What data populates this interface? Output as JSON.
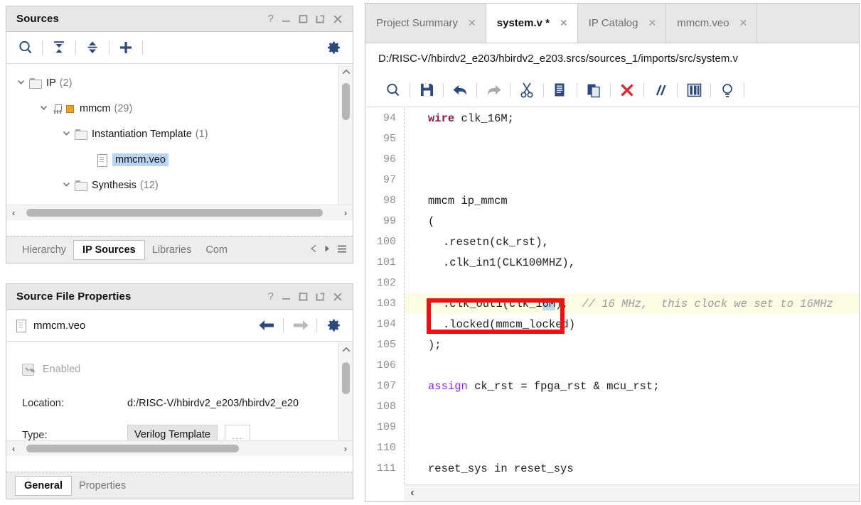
{
  "sources_panel": {
    "title": "Sources",
    "window_controls": [
      "?",
      "minimize",
      "maximize",
      "float",
      "close"
    ],
    "toolbar": [
      {
        "name": "search-icon",
        "label": "Search"
      },
      {
        "name": "collapse-all-icon",
        "label": "Collapse All"
      },
      {
        "name": "expand-all-icon",
        "label": "Expand All"
      },
      {
        "name": "add-sources-icon",
        "label": "Add Sources"
      },
      {
        "name": "settings-gear-icon",
        "label": "Settings"
      }
    ],
    "tree": [
      {
        "label": "IP",
        "count": "(2)",
        "icon": "folder-icon",
        "indent": 0,
        "expanded": true,
        "selected": false
      },
      {
        "label": "mmcm",
        "count": "(29)",
        "icon": "ip-chip-icon",
        "indent": 1,
        "expanded": true,
        "selected": false
      },
      {
        "label": "Instantiation Template",
        "count": "(1)",
        "icon": "folder-icon",
        "indent": 2,
        "expanded": true,
        "selected": false
      },
      {
        "label": "mmcm.veo",
        "count": "",
        "icon": "document-icon",
        "indent": 3,
        "expanded": null,
        "selected": true
      },
      {
        "label": "Synthesis",
        "count": "(12)",
        "icon": "folder-icon",
        "indent": 2,
        "expanded": true,
        "selected": false
      }
    ],
    "bottom_tabs": [
      {
        "label": "Hierarchy",
        "active": false
      },
      {
        "label": "IP Sources",
        "active": true
      },
      {
        "label": "Libraries",
        "active": false
      },
      {
        "label": "Com",
        "active": false
      }
    ],
    "tab_nav": [
      "prev-arrow-icon",
      "next-arrow-icon",
      "tab-menu-icon"
    ]
  },
  "properties_panel": {
    "title": "Source File Properties",
    "window_controls": [
      "?",
      "minimize",
      "maximize",
      "float",
      "close"
    ],
    "file_name": "mmcm.veo",
    "nav": [
      {
        "name": "back-arrow-icon",
        "enabled": true
      },
      {
        "name": "forward-arrow-icon",
        "enabled": false
      },
      {
        "name": "settings-gear-icon",
        "enabled": true
      }
    ],
    "rows": [
      {
        "type": "checkbox",
        "label": "Enabled",
        "checked": true,
        "disabled": true
      },
      {
        "type": "text",
        "label": "Location:",
        "value": "d:/RISC-V/hbirdv2_e203/hbirdv2_e20"
      },
      {
        "type": "select",
        "label": "Type:",
        "value": "Verilog Template",
        "browse": "..."
      }
    ],
    "bottom_tabs": [
      {
        "label": "General",
        "active": true
      },
      {
        "label": "Properties",
        "active": false
      }
    ]
  },
  "editor": {
    "tabs": [
      {
        "label": "Project Summary",
        "active": false,
        "modified": false
      },
      {
        "label": "system.v *",
        "active": true,
        "modified": true
      },
      {
        "label": "IP Catalog",
        "active": false,
        "modified": false
      },
      {
        "label": "mmcm.veo",
        "active": false,
        "modified": false
      }
    ],
    "file_path": "D:/RISC-V/hbirdv2_e203/hbirdv2_e203.srcs/sources_1/imports/src/system.v",
    "toolbar": [
      {
        "name": "find-icon",
        "label": "Find",
        "enabled": true
      },
      {
        "name": "save-icon",
        "label": "Save File",
        "enabled": true
      },
      {
        "name": "undo-icon",
        "label": "Undo",
        "enabled": true
      },
      {
        "name": "redo-icon",
        "label": "Redo",
        "enabled": false
      },
      {
        "name": "cut-icon",
        "label": "Cut",
        "enabled": true
      },
      {
        "name": "copy-icon",
        "label": "Copy",
        "enabled": true
      },
      {
        "name": "paste-icon",
        "label": "Paste",
        "enabled": true
      },
      {
        "name": "delete-icon",
        "label": "Delete",
        "enabled": true
      },
      {
        "name": "comment-icon",
        "label": "Toggle Comment",
        "enabled": true
      },
      {
        "name": "column-select-icon",
        "label": "Column Select",
        "enabled": true
      },
      {
        "name": "bulb-icon",
        "label": "Tips",
        "enabled": true
      }
    ],
    "lines": [
      {
        "n": "94",
        "indent": 1,
        "segments": [
          {
            "t": "wire",
            "c": "kw-wire"
          },
          {
            "t": " clk_16M;",
            "c": ""
          }
        ],
        "current": false
      },
      {
        "n": "95",
        "indent": 0,
        "segments": [],
        "current": false
      },
      {
        "n": "96",
        "indent": 0,
        "segments": [],
        "current": false
      },
      {
        "n": "97",
        "indent": 0,
        "segments": [],
        "current": false
      },
      {
        "n": "98",
        "indent": 1,
        "segments": [
          {
            "t": "mmcm ip_mmcm",
            "c": ""
          }
        ],
        "current": false
      },
      {
        "n": "99",
        "indent": 1,
        "segments": [
          {
            "t": "(",
            "c": ""
          }
        ],
        "current": false
      },
      {
        "n": "100",
        "indent": 2,
        "segments": [
          {
            "t": ".resetn(ck_rst),",
            "c": ""
          }
        ],
        "current": false
      },
      {
        "n": "101",
        "indent": 2,
        "segments": [
          {
            "t": ".clk_in1(CLK100MHZ),",
            "c": ""
          }
        ],
        "current": false
      },
      {
        "n": "102",
        "indent": 0,
        "segments": [],
        "current": false
      },
      {
        "n": "103",
        "indent": 2,
        "segments": [
          {
            "t": ".clk_out1(clk_1",
            "c": ""
          },
          {
            "t": "6M",
            "c": "tok-sel"
          },
          {
            "t": "),  ",
            "c": ""
          },
          {
            "t": "// 16 MHz,  this clock we set to 16MHz",
            "c": "cmt"
          }
        ],
        "current": true
      },
      {
        "n": "104",
        "indent": 2,
        "segments": [
          {
            "t": ".locked(mmcm_locked)",
            "c": ""
          }
        ],
        "current": false
      },
      {
        "n": "105",
        "indent": 1,
        "segments": [
          {
            "t": ");",
            "c": ""
          }
        ],
        "current": false
      },
      {
        "n": "106",
        "indent": 0,
        "segments": [],
        "current": false
      },
      {
        "n": "107",
        "indent": 1,
        "segments": [
          {
            "t": "assign",
            "c": "kw-assign"
          },
          {
            "t": " ck_rst = fpga_rst & mcu_rst;",
            "c": ""
          }
        ],
        "current": false
      },
      {
        "n": "108",
        "indent": 0,
        "segments": [],
        "current": false
      },
      {
        "n": "109",
        "indent": 0,
        "segments": [],
        "current": false
      },
      {
        "n": "110",
        "indent": 0,
        "segments": [],
        "current": false
      },
      {
        "n": "111",
        "indent": 1,
        "segments": [
          {
            "t": "reset_sys in reset_sys",
            "c": ""
          }
        ],
        "current": false
      }
    ],
    "annotation": {
      "name": "red-highlight-box",
      "color": "#ee1111"
    },
    "scroll_arrow": "left-arrow-icon"
  },
  "colors": {
    "panel_header_bg": "#e7e7e7",
    "selection_blue": "#b8d4f2",
    "current_line_yellow": "#fdfbe4",
    "annotation_red": "#ee1111",
    "ip_orange": "#f0a01e",
    "icon_navy": "#2c4a7c",
    "delete_red": "#d9262c"
  }
}
